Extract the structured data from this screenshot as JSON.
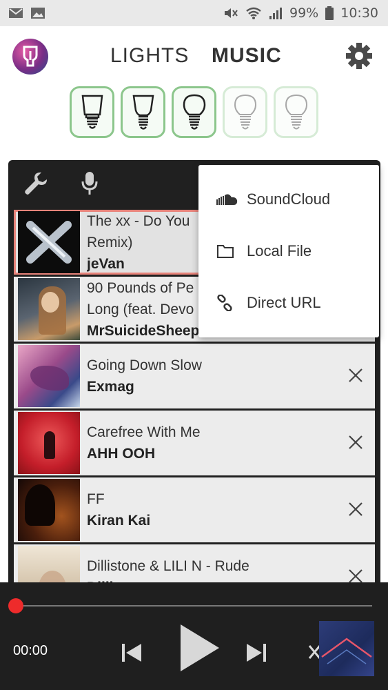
{
  "status_bar": {
    "battery": "99%",
    "time": "10:30",
    "left_icons": [
      "gmail-icon",
      "image-icon"
    ],
    "right_icons": [
      "mute-icon",
      "wifi-icon",
      "signal-icon",
      "battery-icon"
    ]
  },
  "header": {
    "tabs": [
      {
        "label": "LIGHTS",
        "active": false
      },
      {
        "label": "MUSIC",
        "active": true
      }
    ]
  },
  "bulbs": [
    {
      "state": "on"
    },
    {
      "state": "on"
    },
    {
      "state": "on"
    },
    {
      "state": "off"
    },
    {
      "state": "off"
    }
  ],
  "tracks": [
    {
      "title": "The xx - Do You",
      "title2": "Remix)",
      "artist": "jeVan",
      "active": true,
      "art": "#111111"
    },
    {
      "title": "90 Pounds of Pe",
      "title2": "Long (feat. Devo",
      "artist": "MrSuicideSheep",
      "active": false,
      "art": "#3b4a55"
    },
    {
      "title": "Going Down Slow",
      "artist": "Exmag",
      "active": false,
      "art": "#b04a8a"
    },
    {
      "title": "Carefree With Me",
      "artist": "AHH OOH",
      "active": false,
      "art": "#d8383a"
    },
    {
      "title": "FF",
      "artist": "Kiran Kai",
      "active": false,
      "art": "#3a1e12"
    },
    {
      "title": "Dillistone & LILI N - Rude",
      "artist": "Dilli",
      "active": false,
      "art": "#d9cdb8"
    }
  ],
  "dropdown": {
    "items": [
      {
        "label": "SoundCloud",
        "icon": "soundcloud-icon"
      },
      {
        "label": "Local File",
        "icon": "folder-icon"
      },
      {
        "label": "Direct URL",
        "icon": "link-icon"
      }
    ]
  },
  "player": {
    "time": "00:00",
    "progress": 0.0,
    "colors": {
      "accent": "#ee2b2b"
    }
  }
}
